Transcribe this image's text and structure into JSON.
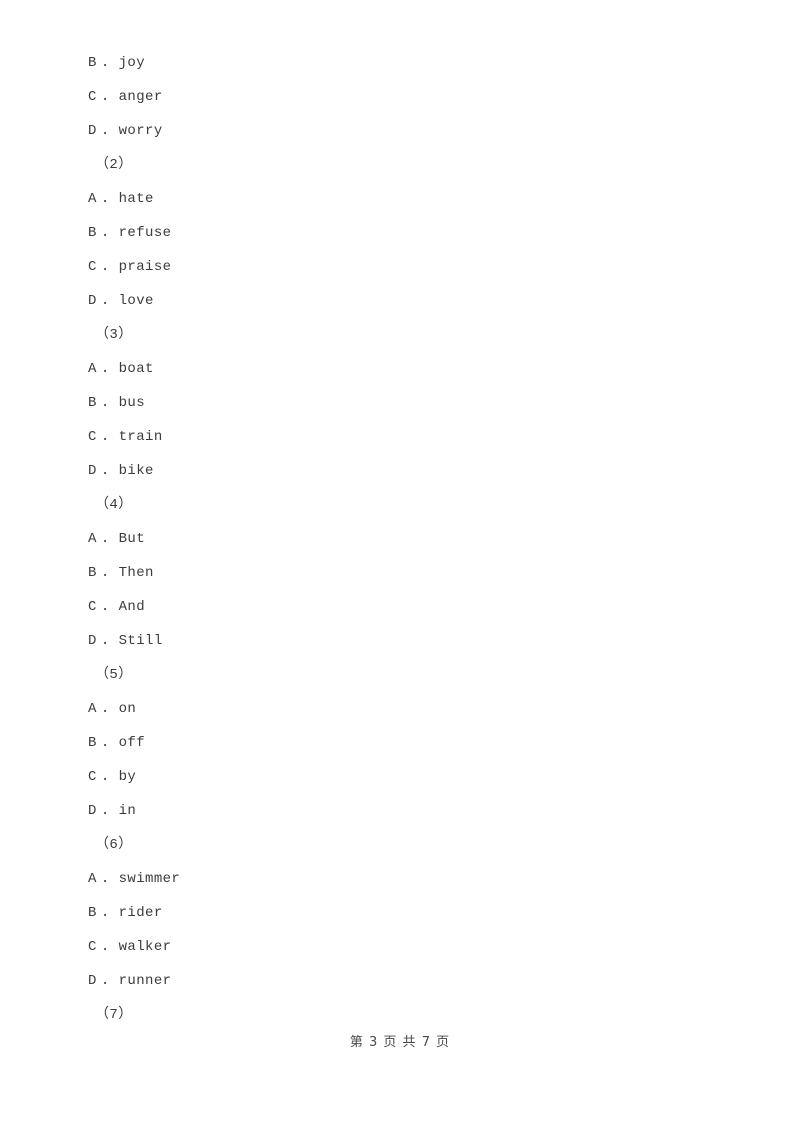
{
  "document": {
    "page_background": "#ffffff",
    "text_color": "#3c3c3c",
    "blocks": [
      {
        "type": "option",
        "letter": "B",
        "separator": ".",
        "text": "joy"
      },
      {
        "type": "option",
        "letter": "C",
        "separator": ".",
        "text": "anger"
      },
      {
        "type": "option",
        "letter": "D",
        "separator": ".",
        "text": "worry"
      },
      {
        "type": "question",
        "label": "（2）"
      },
      {
        "type": "option",
        "letter": "A",
        "separator": ".",
        "text": "hate"
      },
      {
        "type": "option",
        "letter": "B",
        "separator": ".",
        "text": "refuse"
      },
      {
        "type": "option",
        "letter": "C",
        "separator": ".",
        "text": "praise"
      },
      {
        "type": "option",
        "letter": "D",
        "separator": ".",
        "text": "love"
      },
      {
        "type": "question",
        "label": "（3）"
      },
      {
        "type": "option",
        "letter": "A",
        "separator": ".",
        "text": "boat"
      },
      {
        "type": "option",
        "letter": "B",
        "separator": ".",
        "text": "bus"
      },
      {
        "type": "option",
        "letter": "C",
        "separator": ".",
        "text": "train"
      },
      {
        "type": "option",
        "letter": "D",
        "separator": ".",
        "text": "bike"
      },
      {
        "type": "question",
        "label": "（4）"
      },
      {
        "type": "option",
        "letter": "A",
        "separator": ".",
        "text": "But"
      },
      {
        "type": "option",
        "letter": "B",
        "separator": ".",
        "text": "Then"
      },
      {
        "type": "option",
        "letter": "C",
        "separator": ".",
        "text": "And"
      },
      {
        "type": "option",
        "letter": "D",
        "separator": ".",
        "text": "Still"
      },
      {
        "type": "question",
        "label": "（5）"
      },
      {
        "type": "option",
        "letter": "A",
        "separator": ".",
        "text": "on"
      },
      {
        "type": "option",
        "letter": "B",
        "separator": ".",
        "text": "off"
      },
      {
        "type": "option",
        "letter": "C",
        "separator": ".",
        "text": "by"
      },
      {
        "type": "option",
        "letter": "D",
        "separator": ".",
        "text": "in"
      },
      {
        "type": "question",
        "label": "（6）"
      },
      {
        "type": "option",
        "letter": "A",
        "separator": ".",
        "text": "swimmer"
      },
      {
        "type": "option",
        "letter": "B",
        "separator": ".",
        "text": "rider"
      },
      {
        "type": "option",
        "letter": "C",
        "separator": ".",
        "text": "walker"
      },
      {
        "type": "option",
        "letter": "D",
        "separator": ".",
        "text": "runner"
      },
      {
        "type": "question",
        "label": "（7）"
      }
    ],
    "footer": {
      "text": "第 3 页 共 7 页",
      "current_page": "3",
      "total_pages": "7"
    }
  }
}
